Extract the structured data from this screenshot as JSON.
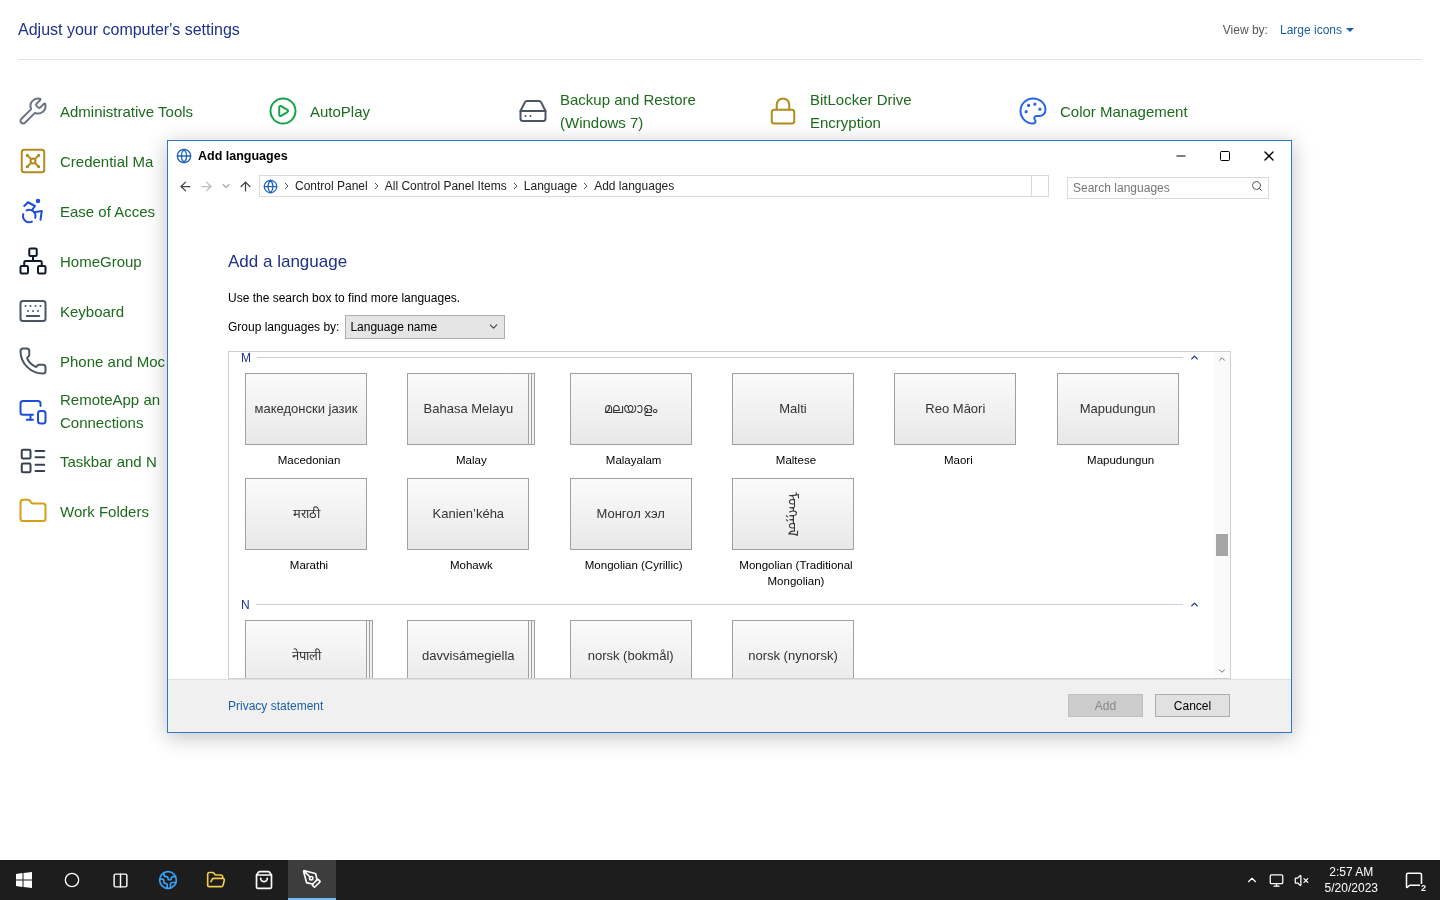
{
  "control_panel": {
    "title": "Adjust your computer's settings",
    "view_by": {
      "label": "View by:",
      "value": "Large icons"
    },
    "rows": [
      [
        {
          "label": "Administrative Tools"
        },
        {
          "label": "AutoPlay"
        },
        {
          "label": "Backup and Restore (Windows 7)"
        },
        {
          "label": "BitLocker Drive Encryption"
        },
        {
          "label": "Color Management"
        }
      ],
      [
        {
          "label": "Credential Ma"
        }
      ],
      [
        {
          "label": "Ease of Acces"
        }
      ],
      [
        {
          "label": "HomeGroup"
        }
      ],
      [
        {
          "label": "Keyboard"
        }
      ],
      [
        {
          "label": "Phone and Moc"
        }
      ],
      [
        {
          "label": "RemoteApp an Connections"
        }
      ],
      [
        {
          "label": "Taskbar and N"
        }
      ],
      [
        {
          "label": "Work Folders"
        }
      ]
    ]
  },
  "dialog": {
    "title": "Add languages",
    "breadcrumbs": [
      "Control Panel",
      "All Control Panel Items",
      "Language",
      "Add languages"
    ],
    "search": {
      "placeholder": "Search languages"
    },
    "heading": "Add a language",
    "hint": "Use the search box to find more languages.",
    "group_by": {
      "label": "Group languages by:",
      "value": "Language name"
    },
    "groups": [
      {
        "letter": "M",
        "languages": [
          {
            "native": "македонски јазик",
            "name": "Macedonian",
            "stacked": false,
            "vertical": false
          },
          {
            "native": "Bahasa Melayu",
            "name": "Malay",
            "stacked": true,
            "vertical": false
          },
          {
            "native": "മലയാളം",
            "name": "Malayalam",
            "stacked": false,
            "vertical": false
          },
          {
            "native": "Malti",
            "name": "Maltese",
            "stacked": false,
            "vertical": false
          },
          {
            "native": "Reo Māori",
            "name": "Maori",
            "stacked": false,
            "vertical": false
          },
          {
            "native": "Mapudungun",
            "name": "Mapudungun",
            "stacked": false,
            "vertical": false
          },
          {
            "native": "मराठी",
            "name": "Marathi",
            "stacked": false,
            "vertical": false
          },
          {
            "native": "Kanien’kéha",
            "name": "Mohawk",
            "stacked": false,
            "vertical": false
          },
          {
            "native": "Монгол хэл",
            "name": "Mongolian (Cyrillic)",
            "stacked": false,
            "vertical": false
          },
          {
            "native": "ᠮᠣᠩᠭᠣᠯ",
            "name": "Mongolian (Traditional Mongolian)",
            "stacked": false,
            "vertical": true
          }
        ]
      },
      {
        "letter": "N",
        "languages": [
          {
            "native": "नेपाली",
            "stacked": true,
            "vertical": false
          },
          {
            "native": "davvisámegiella",
            "stacked": true,
            "vertical": false
          },
          {
            "native": "norsk (bokmål)",
            "stacked": false,
            "vertical": false
          },
          {
            "native": "norsk (nynorsk)",
            "stacked": false,
            "vertical": false
          }
        ]
      }
    ],
    "privacy_link": "Privacy statement",
    "buttons": [
      {
        "label": "Add",
        "disabled": true
      },
      {
        "label": "Cancel",
        "disabled": false
      }
    ]
  },
  "taskbar": {
    "apps": [
      {
        "selected": false
      },
      {
        "selected": false
      },
      {
        "selected": false
      },
      {
        "selected": true
      }
    ],
    "time": "2:57 AM",
    "date": "5/20/2023",
    "notification_count": "2"
  }
}
